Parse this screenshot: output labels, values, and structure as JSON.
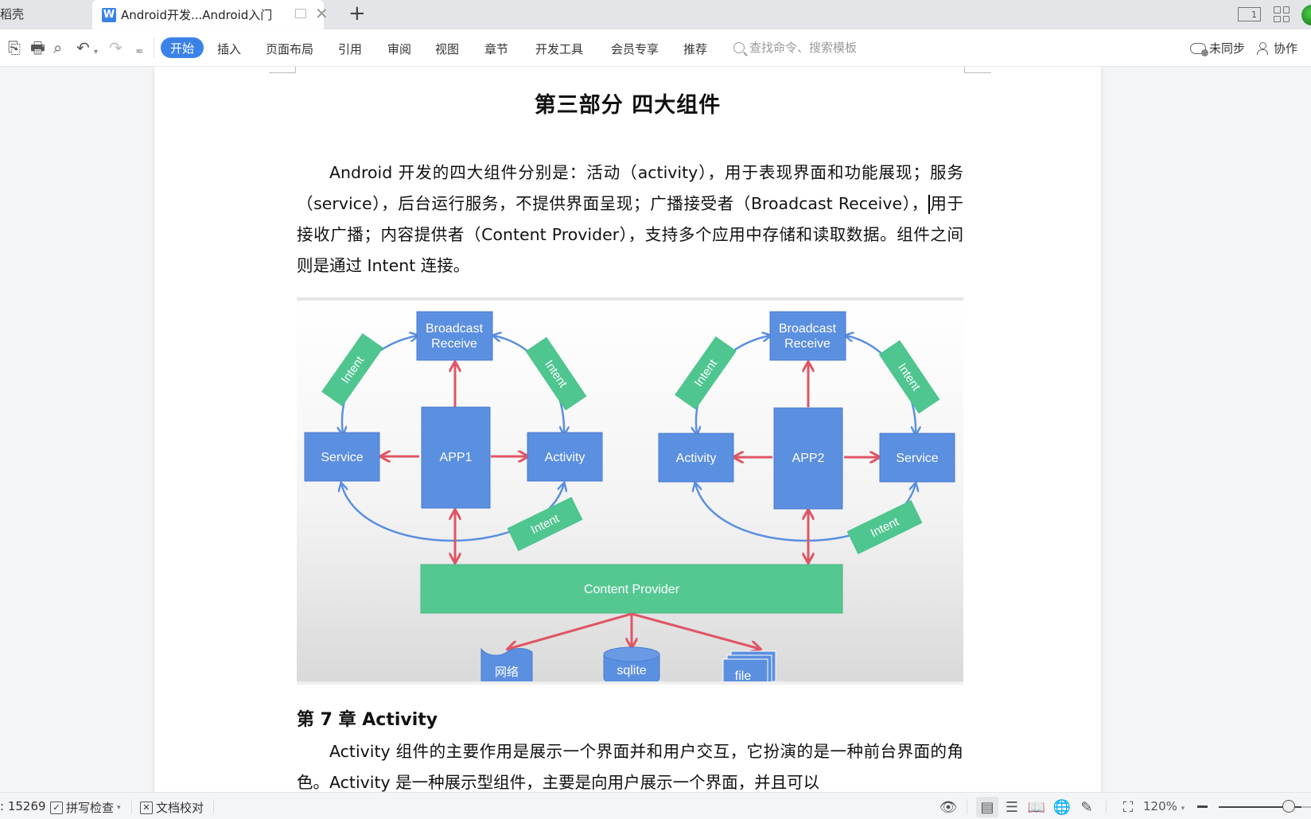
{
  "tabbar": {
    "prev_tab_label": "稻壳",
    "active_tab_title": "Android开发...Android入门",
    "doc_icon_glyph": "W",
    "layout_label": "1"
  },
  "ribbon": {
    "menus": [
      "开始",
      "插入",
      "页面布局",
      "引用",
      "审阅",
      "视图",
      "章节",
      "开发工具",
      "会员专享",
      "推荐"
    ],
    "active_menu": "开始",
    "search_placeholder": "查找命令、搜索模板",
    "sync_label": "未同步",
    "collab_label": "协作",
    "accent_color": "#3b82e8"
  },
  "document": {
    "title": "第三部分  四大组件",
    "paragraph1": "Android 开发的四大组件分别是：活动（activity），用于表现界面和功能展现；服务（service），后台运行服务，不提供界面呈现；广播接受者（Broadcast Receive），用于接收广播；内容提供者（Content Provider），支持多个应用中存储和读取数据。组件之间则是通过 Intent 连接。",
    "chapter_heading": "第 7 章  Activity",
    "paragraph2": "Activity 组件的主要作用是展示一个界面并和用户交互，它扮演的是一种前台界面的角色。Activity 是一种展示型组件，主要是向用户展示一个界面，并且可以"
  },
  "diagram": {
    "left": {
      "app": "APP1",
      "top": "Broadcast Receive",
      "left_node": "Service",
      "right_node": "Activity",
      "intent_label": "Intent"
    },
    "right": {
      "app": "APP2",
      "top": "Broadcast Receive",
      "left_node": "Activity",
      "right_node": "Service",
      "intent_label": "Intent"
    },
    "provider": "Content Provider",
    "storage": [
      "网络",
      "sqlite",
      "file"
    ],
    "colors": {
      "node": "#5b8fe0",
      "intent": "#4fc58f",
      "arrow_red": "#e05565",
      "arrow_blue": "#5b8fe0"
    }
  },
  "statusbar": {
    "word_count": ": 15269",
    "spell_check": "拼写检查",
    "doc_proof": "文档校对",
    "zoom": "120%",
    "zoom_slider_fraction": 0.77
  }
}
